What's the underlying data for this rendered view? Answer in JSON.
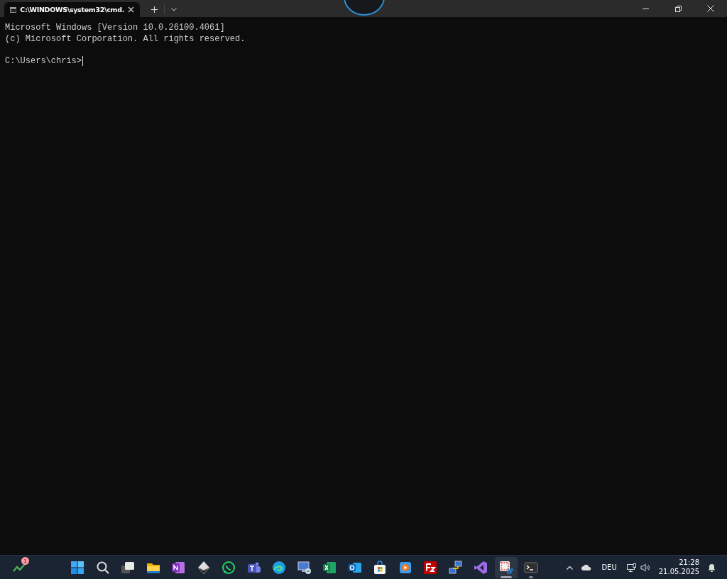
{
  "window": {
    "tab_title": "C:\\WINDOWS\\system32\\cmd.",
    "tab_selected": true
  },
  "console": {
    "output": [
      "Microsoft Windows [Version 10.0.26100.4061]",
      "(c) Microsoft Corporation. All rights reserved."
    ],
    "prompt": "C:\\Users\\chris>",
    "cursor": true
  },
  "taskbar": {
    "widget_badge": "1",
    "apps": [
      {
        "kind": "start",
        "selected": false,
        "running": false
      },
      {
        "kind": "search",
        "selected": false,
        "running": false
      },
      {
        "kind": "taskview",
        "selected": false,
        "running": false
      },
      {
        "kind": "folder",
        "selected": false,
        "running": false
      },
      {
        "kind": "notebook",
        "selected": false,
        "running": false
      },
      {
        "kind": "diamond",
        "selected": false,
        "running": false
      },
      {
        "kind": "chat",
        "selected": false,
        "running": false
      },
      {
        "kind": "people",
        "selected": false,
        "running": false
      },
      {
        "kind": "swirl",
        "selected": false,
        "running": false
      },
      {
        "kind": "monitor",
        "selected": false,
        "running": false
      },
      {
        "kind": "sheet",
        "selected": false,
        "running": false
      },
      {
        "kind": "mail",
        "selected": false,
        "running": false
      },
      {
        "kind": "bag",
        "selected": false,
        "running": false
      },
      {
        "kind": "play",
        "selected": false,
        "running": false
      },
      {
        "kind": "redtile",
        "selected": false,
        "running": false
      },
      {
        "kind": "network",
        "selected": false,
        "running": false
      },
      {
        "kind": "ribbon",
        "selected": false,
        "running": false
      },
      {
        "kind": "snip",
        "selected": true,
        "running": true
      },
      {
        "kind": "terminal",
        "selected": false,
        "running": true
      }
    ],
    "language": "DEU",
    "time": "21:28",
    "date": "21.05.2025"
  }
}
